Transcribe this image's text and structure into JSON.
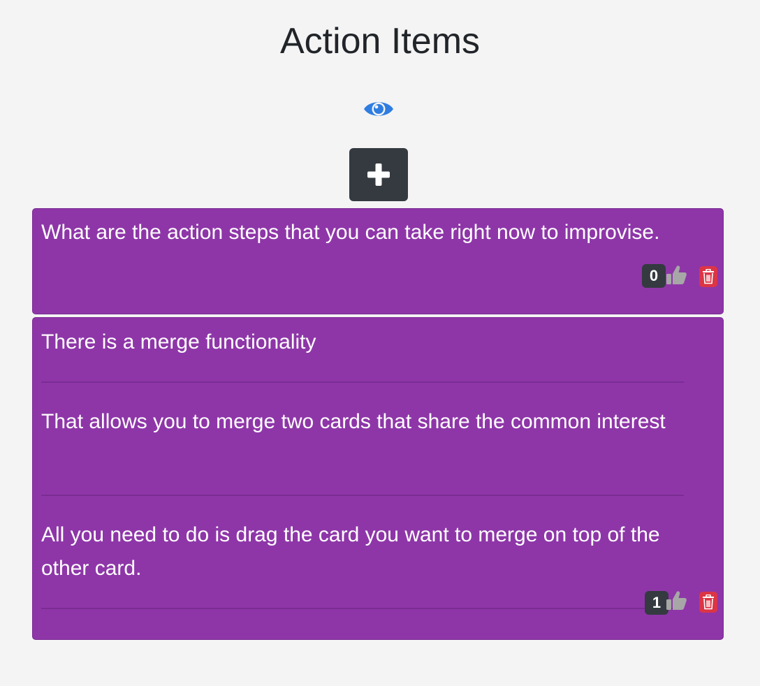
{
  "page": {
    "title": "Action Items"
  },
  "toolbar": {
    "view_icon": "eye-icon",
    "add_icon": "plus-icon"
  },
  "colors": {
    "card_background": "#8e36a8",
    "add_button": "#343a40",
    "eye_icon": "#2f7de1",
    "delete_button": "#dc3545",
    "badge": "#343a40"
  },
  "cards": [
    {
      "items": [
        "What are the action steps that you can take right now to improvise."
      ],
      "votes": "0"
    },
    {
      "items": [
        "There is a merge functionality",
        "That allows you to merge two cards that share the common interest",
        "All you need to do is drag the card you want to merge on top of the other card."
      ],
      "votes": "1"
    }
  ]
}
